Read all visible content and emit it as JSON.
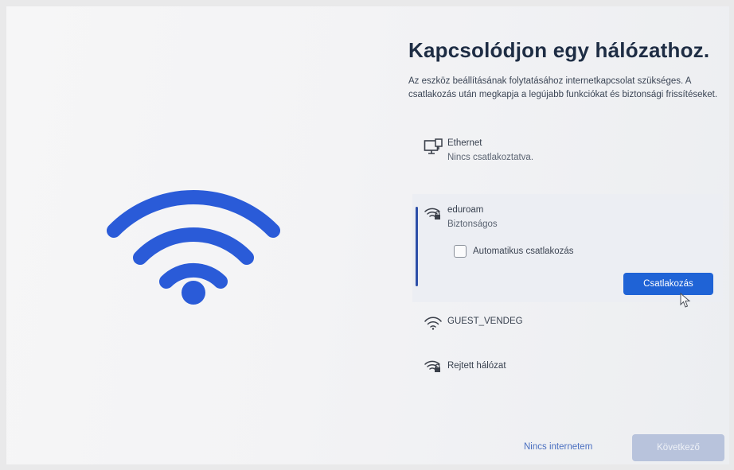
{
  "page": {
    "title": "Kapcsolódjon egy hálózathoz.",
    "description": "Az eszköz beállításának folytatásához internetkapcsolat szükséges. A csatlakozás után megkapja a legújabb funkciókat és biztonsági frissítéseket."
  },
  "networks": {
    "ethernet": {
      "name": "Ethernet",
      "status": "Nincs csatlakoztatva.",
      "icon": "ethernet-icon"
    },
    "eduroam": {
      "name": "eduroam",
      "status": "Biztonságos",
      "icon": "wifi-lock-icon",
      "auto_connect_label": "Automatikus csatlakozás",
      "auto_connect_checked": false,
      "connect_label": "Csatlakozás"
    },
    "guest": {
      "name": "GUEST_VENDEG",
      "icon": "wifi-icon"
    },
    "hidden": {
      "name": "Rejtett hálózat",
      "icon": "wifi-lock-icon"
    }
  },
  "footer": {
    "no_internet_label": "Nincs internetem",
    "next_label": "Következő"
  },
  "colors": {
    "accent": "#1f63d6",
    "hero_wifi": "#2a5bd8",
    "title": "#1e2d44",
    "disabled_button": "#b8c3dc"
  }
}
